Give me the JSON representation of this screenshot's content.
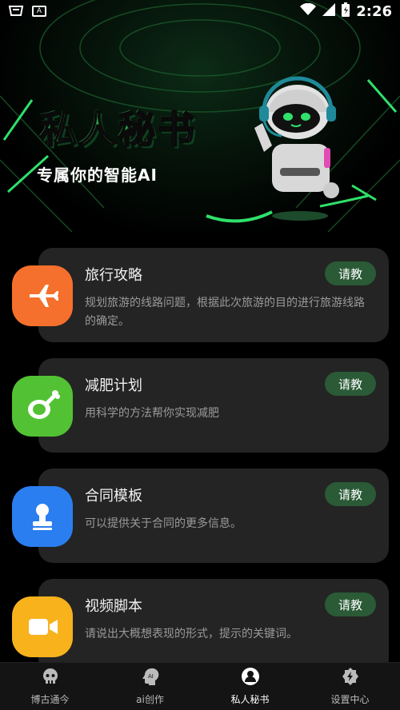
{
  "status_bar": {
    "time": "2:26",
    "notif_icons": [
      "basket-icon",
      "a-icon"
    ],
    "sys_icons": [
      "wifi-icon",
      "signal-icon",
      "battery-icon"
    ]
  },
  "hero": {
    "title": "私人秘书",
    "subtitle": "专属你的智能AI",
    "colors": {
      "title": "#2aa24a",
      "accent": "#1fbf5a"
    }
  },
  "cards": [
    {
      "title": "旅行攻略",
      "desc": "规划旅游的线路问题，根据此次旅游的目的进行旅游线路的确定。",
      "button": "请教",
      "icon": "airplane-icon",
      "color": "#f5702c"
    },
    {
      "title": "减肥计划",
      "desc": "用科学的方法帮你实现减肥",
      "button": "请教",
      "icon": "meat-icon",
      "color": "#52c234"
    },
    {
      "title": "合同模板",
      "desc": "可以提供关于合同的更多信息。",
      "button": "请教",
      "icon": "stamp-icon",
      "color": "#2a7ef0"
    },
    {
      "title": "视频脚本",
      "desc": "请说出大概想表现的形式，提示的关键词。",
      "button": "请教",
      "icon": "video-camera-icon",
      "color": "#f7b21c"
    }
  ],
  "nav": [
    {
      "label": "博古通今",
      "icon": "skull-icon",
      "active": false
    },
    {
      "label": "ai创作",
      "icon": "ai-head-icon",
      "active": false
    },
    {
      "label": "私人秘书",
      "icon": "user-circle-icon",
      "active": true
    },
    {
      "label": "设置中心",
      "icon": "settings-icon",
      "active": false
    }
  ]
}
